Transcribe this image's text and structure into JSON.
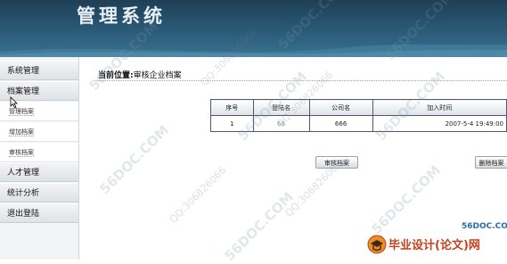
{
  "header": {
    "title": "管理系统"
  },
  "sidebar": {
    "items": [
      {
        "label": "系统管理"
      },
      {
        "label": "档案管理"
      },
      {
        "label": "管理档案"
      },
      {
        "label": "增加档案"
      },
      {
        "label": "审核档案"
      },
      {
        "label": "人才管理"
      },
      {
        "label": "统计分析"
      },
      {
        "label": "退出登陆"
      }
    ]
  },
  "location": {
    "label": "当前位置:",
    "value": "审核企业档案"
  },
  "table": {
    "headers": [
      "序号",
      "登陆名",
      "公司名",
      "加入时间"
    ],
    "rows": [
      {
        "index": "1",
        "login": "66",
        "company": "666",
        "time": "2007-5-4 19:49:00"
      }
    ]
  },
  "buttons": {
    "approve": "审核档案",
    "delete": "删除档案"
  },
  "watermarks": {
    "site": "56DOC.COM",
    "qq": "QQ:306826066"
  },
  "logo": {
    "site": "56DOC.COM",
    "brand": "毕业设计(论文)网"
  },
  "colors": {
    "header": "#2b5b78",
    "brand": "#c2411e",
    "site": "#2a6ea6"
  }
}
